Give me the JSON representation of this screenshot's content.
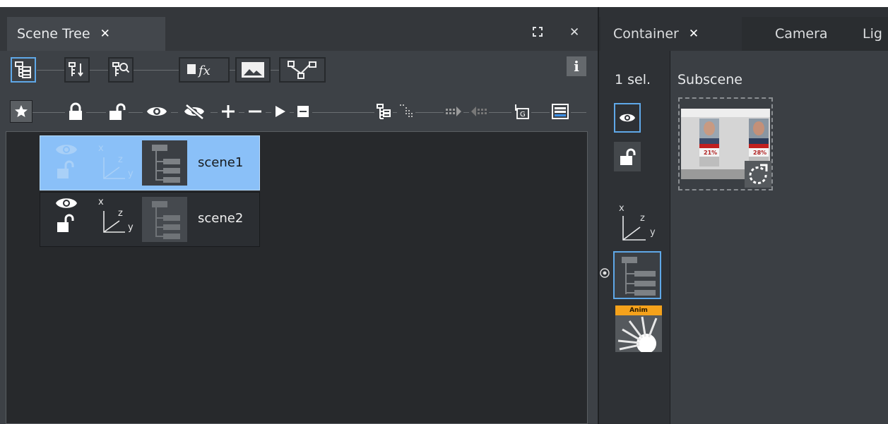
{
  "left_panel": {
    "tab_title": "Scene Tree",
    "tab_close": "✕",
    "expand_glyph": "⛶",
    "close_glyph": "✕",
    "info_glyph": "i",
    "rows": [
      {
        "label": "scene1",
        "selected": true,
        "axis": {
          "x": "x",
          "z": "z",
          "y": "y"
        }
      },
      {
        "label": "scene2",
        "selected": false,
        "axis": {
          "x": "x",
          "z": "z",
          "y": "y"
        }
      }
    ]
  },
  "right_panel": {
    "tabs": [
      {
        "label": "Container",
        "close": "✕",
        "active": true
      },
      {
        "label": "Camera",
        "active": false
      },
      {
        "label": "Lig",
        "active": false
      }
    ],
    "selection_count": "1 sel.",
    "section_label": "Subscene",
    "axis": {
      "x": "x",
      "z": "z",
      "y": "y"
    },
    "anim_badge": "Anim",
    "thumb_pct_left": "21%",
    "thumb_pct_right": "28%"
  },
  "colors": {
    "accent": "#5fa8e8",
    "selection": "#8ac0f8",
    "anim": "#f5a21b"
  }
}
